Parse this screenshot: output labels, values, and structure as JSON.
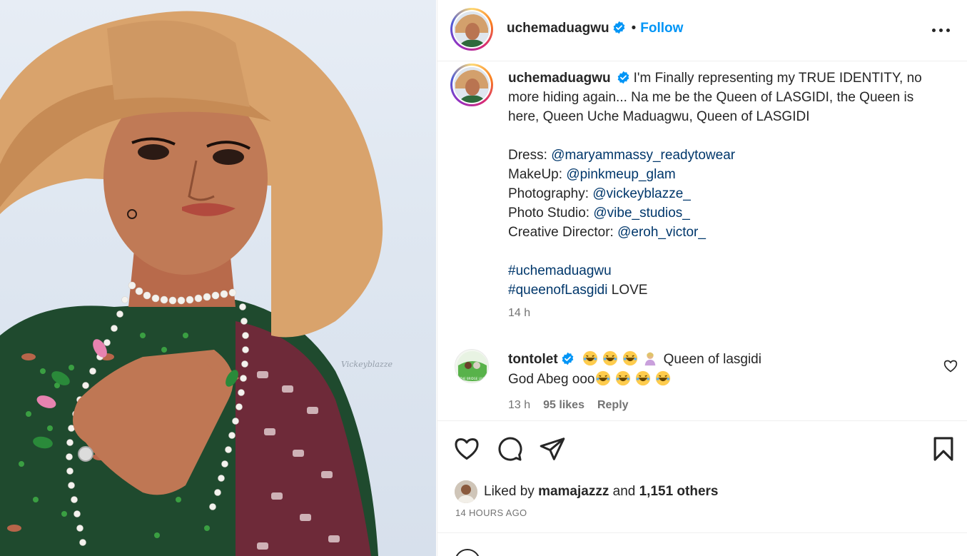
{
  "post": {
    "author": "uchemaduagwu",
    "follow_label": "Follow",
    "dot": "•",
    "caption": {
      "intro": "I'm Finally representing my TRUE IDENTITY, no more hiding again... Na me be the Queen of LASGIDI, the Queen is here, Queen Uche Maduagwu, Queen of LASGIDI",
      "credits": [
        {
          "label": "Dress: ",
          "handle": "@maryammassy_readytowear"
        },
        {
          "label": "MakeUp: ",
          "handle": "@pinkmeup_glam"
        },
        {
          "label": "Photography: ",
          "handle": "@vickeyblazze_"
        },
        {
          "label": "Photo Studio: ",
          "handle": "@vibe_studios_"
        },
        {
          "label": "Creative Director: ",
          "handle": "@eroh_victor_"
        }
      ],
      "hashtag1": "#uchemaduagwu",
      "hashtag2": "#queenofLasgidi",
      "hashtag2_suffix": " LOVE",
      "time": "14 h"
    },
    "photo_watermark": "Vickeyblazze"
  },
  "comment": {
    "author": "tontolet",
    "line1_text": "Queen of lasgidi",
    "line2_text": "God Abeg ooo",
    "time": "13 h",
    "likes": "95 likes",
    "reply_label": "Reply",
    "avatar_caption": "THE BRIDGE LIVE"
  },
  "engagement": {
    "liked_by_prefix": "Liked by ",
    "liked_by_user": "mamajazzz",
    "liked_by_and": " and ",
    "liked_by_count": "1,151 others",
    "posted_ago": "14 HOURS AGO"
  },
  "colors": {
    "accent": "#0095f6",
    "link": "#00376b",
    "muted": "#737373",
    "text": "#262626",
    "verified": "#0095f6"
  },
  "icons": {
    "more": "more-options-icon",
    "verified": "verified-badge-icon",
    "like": "heart-icon",
    "comment": "comment-icon",
    "share": "share-icon",
    "save": "bookmark-icon",
    "emoji": "emoji-icon"
  }
}
